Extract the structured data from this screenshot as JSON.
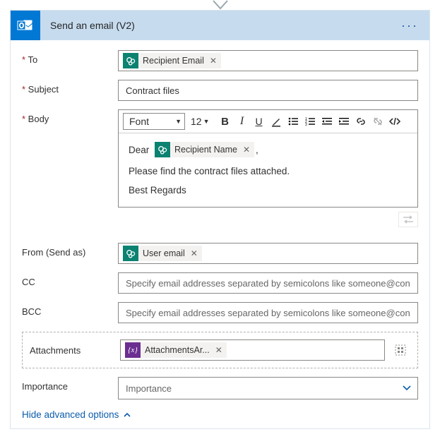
{
  "action": {
    "title": "Send an email (V2)"
  },
  "fields": {
    "to": {
      "label": "To",
      "token": "Recipient Email"
    },
    "subject": {
      "label": "Subject",
      "value": "Contract files"
    },
    "body": {
      "label": "Body",
      "font_label": "Font",
      "font_size": "12",
      "greeting_prefix": "Dear",
      "greeting_token": "Recipient Name",
      "greeting_suffix": ",",
      "line2": "Please find the contract files attached.",
      "line3": "Best Regards"
    },
    "from": {
      "label": "From (Send as)",
      "token": "User email"
    },
    "cc": {
      "label": "CC",
      "placeholder": "Specify email addresses separated by semicolons like someone@contoso.com"
    },
    "bcc": {
      "label": "BCC",
      "placeholder": "Specify email addresses separated by semicolons like someone@contoso.com"
    },
    "attachments": {
      "label": "Attachments",
      "token": "AttachmentsAr..."
    },
    "importance": {
      "label": "Importance",
      "placeholder": "Importance"
    }
  },
  "footer": {
    "toggle_label": "Hide advanced options"
  }
}
